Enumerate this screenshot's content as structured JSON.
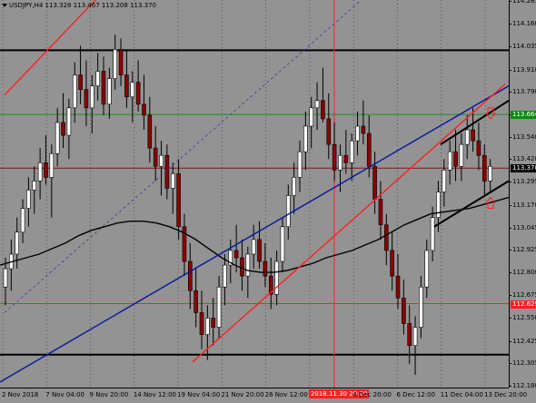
{
  "header": {
    "symbol": "USDJPY,H4",
    "quote": "113.328 113.467 113.208 113.370"
  },
  "chart_data": {
    "type": "candlestick",
    "symbol": "USDJPY",
    "timeframe": "H4",
    "price_axis": {
      "ticks": [
        114.285,
        114.16,
        114.035,
        113.91,
        113.79,
        113.664,
        113.54,
        113.42,
        113.295,
        113.17,
        113.045,
        112.925,
        112.8,
        112.675,
        112.55,
        112.425,
        112.305,
        112.18
      ],
      "labels": [
        "114.285",
        "114.160",
        "114.035",
        "113.910",
        "113.790",
        "113.664",
        "113.540",
        "113.420",
        "113.295",
        "113.170",
        "113.045",
        "112.925",
        "112.800",
        "112.675",
        "112.550",
        "112.425",
        "112.305",
        "112.180"
      ],
      "range": [
        112.17,
        114.29
      ]
    },
    "time_axis": {
      "labels": [
        "2 Nov 2018",
        "7 Nov 04:00",
        "9 Nov 20:00",
        "14 Nov 12:00",
        "19 Nov 04:00",
        "21 Nov 20:00",
        "26 Nov 12:00",
        "2018.11.30 20:00",
        "4 Dec 20:00",
        "6 Dec 12:00",
        "11 Dec 04:00",
        "13 Dec 20:00"
      ],
      "highlighted": "2018.11.30 20:00"
    },
    "price_badges": [
      {
        "label": "113.664",
        "price": 113.664,
        "color": "#0a8a0a"
      },
      {
        "label": "113.370",
        "price": 113.37,
        "color": "#000000"
      },
      {
        "label": "112.629",
        "price": 112.629,
        "color": "#ff2020"
      }
    ],
    "horizontal_lines": [
      {
        "price": 114.015,
        "color": "#000000",
        "width": 2
      },
      {
        "price": 113.664,
        "color": "#1a8f1a",
        "width": 1
      },
      {
        "price": 113.37,
        "color": "#8a1010",
        "width": 1
      },
      {
        "price": 112.629,
        "color": "#ff2020",
        "width": 1
      },
      {
        "price": 112.35,
        "color": "#000000",
        "width": 2
      }
    ],
    "candles": [
      [
        112.72,
        112.88,
        112.62,
        112.82
      ],
      [
        112.82,
        112.98,
        112.7,
        112.9
      ],
      [
        112.9,
        113.1,
        112.82,
        113.02
      ],
      [
        113.02,
        113.2,
        112.96,
        113.15
      ],
      [
        113.15,
        113.32,
        113.05,
        113.25
      ],
      [
        113.25,
        113.38,
        113.12,
        113.3
      ],
      [
        113.3,
        113.48,
        113.2,
        113.4
      ],
      [
        113.4,
        113.55,
        113.28,
        113.32
      ],
      [
        113.32,
        113.5,
        113.1,
        113.45
      ],
      [
        113.45,
        113.7,
        113.38,
        113.62
      ],
      [
        113.62,
        113.78,
        113.48,
        113.55
      ],
      [
        113.55,
        113.75,
        113.42,
        113.7
      ],
      [
        113.7,
        113.95,
        113.62,
        113.88
      ],
      [
        113.88,
        114.04,
        113.72,
        113.8
      ],
      [
        113.8,
        113.96,
        113.6,
        113.7
      ],
      [
        113.7,
        113.88,
        113.56,
        113.82
      ],
      [
        113.82,
        114.0,
        113.74,
        113.9
      ],
      [
        113.9,
        113.98,
        113.66,
        113.72
      ],
      [
        113.72,
        113.92,
        113.64,
        113.86
      ],
      [
        113.86,
        114.1,
        113.8,
        114.02
      ],
      [
        114.02,
        114.08,
        113.82,
        113.88
      ],
      [
        113.88,
        114.02,
        113.7,
        113.76
      ],
      [
        113.76,
        113.9,
        113.62,
        113.84
      ],
      [
        113.84,
        113.96,
        113.68,
        113.72
      ],
      [
        113.72,
        113.88,
        113.58,
        113.66
      ],
      [
        113.66,
        113.76,
        113.4,
        113.48
      ],
      [
        113.48,
        113.6,
        113.3,
        113.38
      ],
      [
        113.38,
        113.52,
        113.22,
        113.44
      ],
      [
        113.44,
        113.5,
        113.2,
        113.26
      ],
      [
        113.26,
        113.4,
        113.12,
        113.34
      ],
      [
        113.34,
        113.42,
        112.98,
        113.05
      ],
      [
        113.05,
        113.12,
        112.78,
        112.86
      ],
      [
        112.86,
        112.96,
        112.6,
        112.7
      ],
      [
        112.7,
        112.82,
        112.5,
        112.58
      ],
      [
        112.58,
        112.7,
        112.38,
        112.46
      ],
      [
        112.46,
        112.62,
        112.32,
        112.55
      ],
      [
        112.55,
        112.66,
        112.4,
        112.5
      ],
      [
        112.5,
        112.78,
        112.44,
        112.72
      ],
      [
        112.72,
        112.9,
        112.62,
        112.84
      ],
      [
        112.84,
        112.98,
        112.74,
        112.92
      ],
      [
        112.92,
        113.06,
        112.8,
        112.88
      ],
      [
        112.88,
        112.98,
        112.7,
        112.78
      ],
      [
        112.78,
        112.94,
        112.66,
        112.9
      ],
      [
        112.9,
        113.06,
        112.82,
        112.98
      ],
      [
        112.98,
        113.08,
        112.82,
        112.86
      ],
      [
        112.86,
        112.96,
        112.72,
        112.78
      ],
      [
        112.78,
        112.88,
        112.6,
        112.68
      ],
      [
        112.68,
        112.92,
        112.62,
        112.86
      ],
      [
        112.86,
        113.1,
        112.8,
        113.05
      ],
      [
        113.05,
        113.28,
        112.98,
        113.22
      ],
      [
        113.22,
        113.4,
        113.12,
        113.32
      ],
      [
        113.32,
        113.52,
        113.24,
        113.46
      ],
      [
        113.46,
        113.68,
        113.36,
        113.6
      ],
      [
        113.6,
        113.76,
        113.48,
        113.7
      ],
      [
        113.7,
        113.84,
        113.58,
        113.74
      ],
      [
        113.74,
        113.92,
        113.62,
        113.64
      ],
      [
        113.64,
        113.78,
        113.42,
        113.5
      ],
      [
        113.5,
        113.62,
        113.3,
        113.36
      ],
      [
        113.36,
        113.5,
        113.24,
        113.44
      ],
      [
        113.44,
        113.58,
        113.34,
        113.4
      ],
      [
        113.4,
        113.56,
        113.3,
        113.52
      ],
      [
        113.52,
        113.68,
        113.44,
        113.6
      ],
      [
        113.6,
        113.74,
        113.5,
        113.56
      ],
      [
        113.56,
        113.66,
        113.32,
        113.38
      ],
      [
        113.38,
        113.46,
        113.12,
        113.2
      ],
      [
        113.2,
        113.3,
        112.98,
        113.06
      ],
      [
        113.06,
        113.12,
        112.84,
        112.92
      ],
      [
        112.92,
        113.02,
        112.7,
        112.78
      ],
      [
        112.78,
        112.9,
        112.6,
        112.66
      ],
      [
        112.66,
        112.76,
        112.46,
        112.52
      ],
      [
        112.52,
        112.62,
        112.3,
        112.4
      ],
      [
        112.4,
        112.56,
        112.24,
        112.5
      ],
      [
        112.5,
        112.78,
        112.44,
        112.72
      ],
      [
        112.72,
        112.98,
        112.66,
        112.92
      ],
      [
        112.92,
        113.16,
        112.86,
        113.1
      ],
      [
        113.1,
        113.3,
        113.02,
        113.24
      ],
      [
        113.24,
        113.42,
        113.16,
        113.36
      ],
      [
        113.36,
        113.52,
        113.28,
        113.46
      ],
      [
        113.46,
        113.58,
        113.3,
        113.38
      ],
      [
        113.38,
        113.56,
        113.3,
        113.5
      ],
      [
        113.5,
        113.66,
        113.42,
        113.58
      ],
      [
        113.58,
        113.7,
        113.46,
        113.52
      ],
      [
        113.52,
        113.62,
        113.36,
        113.44
      ],
      [
        113.44,
        113.5,
        113.22,
        113.3
      ],
      [
        113.3,
        113.42,
        113.24,
        113.38
      ]
    ],
    "moving_average": [
      112.84,
      112.86,
      112.88,
      112.9,
      112.93,
      112.96,
      113.0,
      113.03,
      113.05,
      113.07,
      113.08,
      113.08,
      113.07,
      113.05,
      113.02,
      112.98,
      112.93,
      112.88,
      112.84,
      112.81,
      112.8,
      112.8,
      112.81,
      112.83,
      112.85,
      112.88,
      112.9,
      112.92,
      112.95,
      112.98,
      113.02,
      113.06,
      113.09,
      113.12,
      113.13,
      113.14,
      113.15,
      113.17,
      113.19,
      113.21
    ],
    "trend_lines": [
      {
        "from": [
          0,
          112.2
        ],
        "to": [
          560,
          113.82
        ],
        "color": "#0018a0",
        "style": "solid"
      },
      {
        "from": [
          212,
          112.31
        ],
        "to": [
          556,
          113.83
        ],
        "color": "#ff2020",
        "style": "solid"
      },
      {
        "from": [
          5,
          113.77
        ],
        "to": [
          107,
          114.3
        ],
        "color": "#ff2020",
        "style": "solid"
      },
      {
        "from": [
          5,
          112.58
        ],
        "to": [
          400,
          114.3
        ],
        "color": "#3a3aa0",
        "style": "dashed"
      },
      {
        "from": [
          478,
          113.05
        ],
        "to": [
          560,
          113.3
        ],
        "color": "#000000",
        "style": "solid"
      },
      {
        "from": [
          485,
          113.5
        ],
        "to": [
          560,
          113.74
        ],
        "color": "#000000",
        "style": "solid"
      }
    ],
    "vertical_line": {
      "x_label": "2018.11.30 20:00",
      "color": "#ff2020"
    },
    "arrows": [
      {
        "direction": "down",
        "price": 113.66,
        "color": "#ff2020"
      },
      {
        "direction": "up",
        "price": 113.19,
        "color": "#ff2020"
      }
    ]
  }
}
